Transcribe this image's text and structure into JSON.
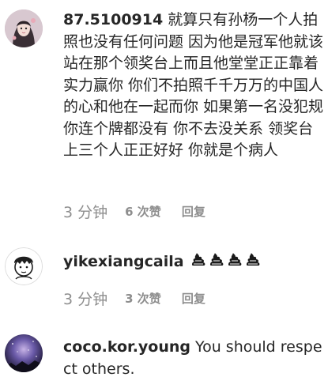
{
  "comments": [
    {
      "username": "87.5100914",
      "text": "就算只有孙杨一个人拍照也没有任何问题 因为他是冠军他就该站在那个领奖台上而且他堂堂正正靠着实力赢你 你们不拍照千千万万的中国人的心和他在一起而你 如果第一名没犯规 你连个牌都没有 你不去没关系 领奖台上三个人正正好好 你就是个病人",
      "time": "3 分钟",
      "likes": "6 次赞",
      "reply": "回复",
      "avatar_icon": "anime-girl-avatar-icon"
    },
    {
      "username": "yikexiangcaila",
      "emoji_icons": [
        "poop-icon",
        "poop-icon",
        "poop-icon",
        "poop-icon"
      ],
      "time": "3 分钟",
      "likes": "3 次赞",
      "reply": "回复",
      "avatar_icon": "cartoon-boy-avatar-icon"
    },
    {
      "username": "coco.kor.young",
      "text": "You should respect others.",
      "avatar_icon": "galaxy-avatar-icon"
    }
  ]
}
